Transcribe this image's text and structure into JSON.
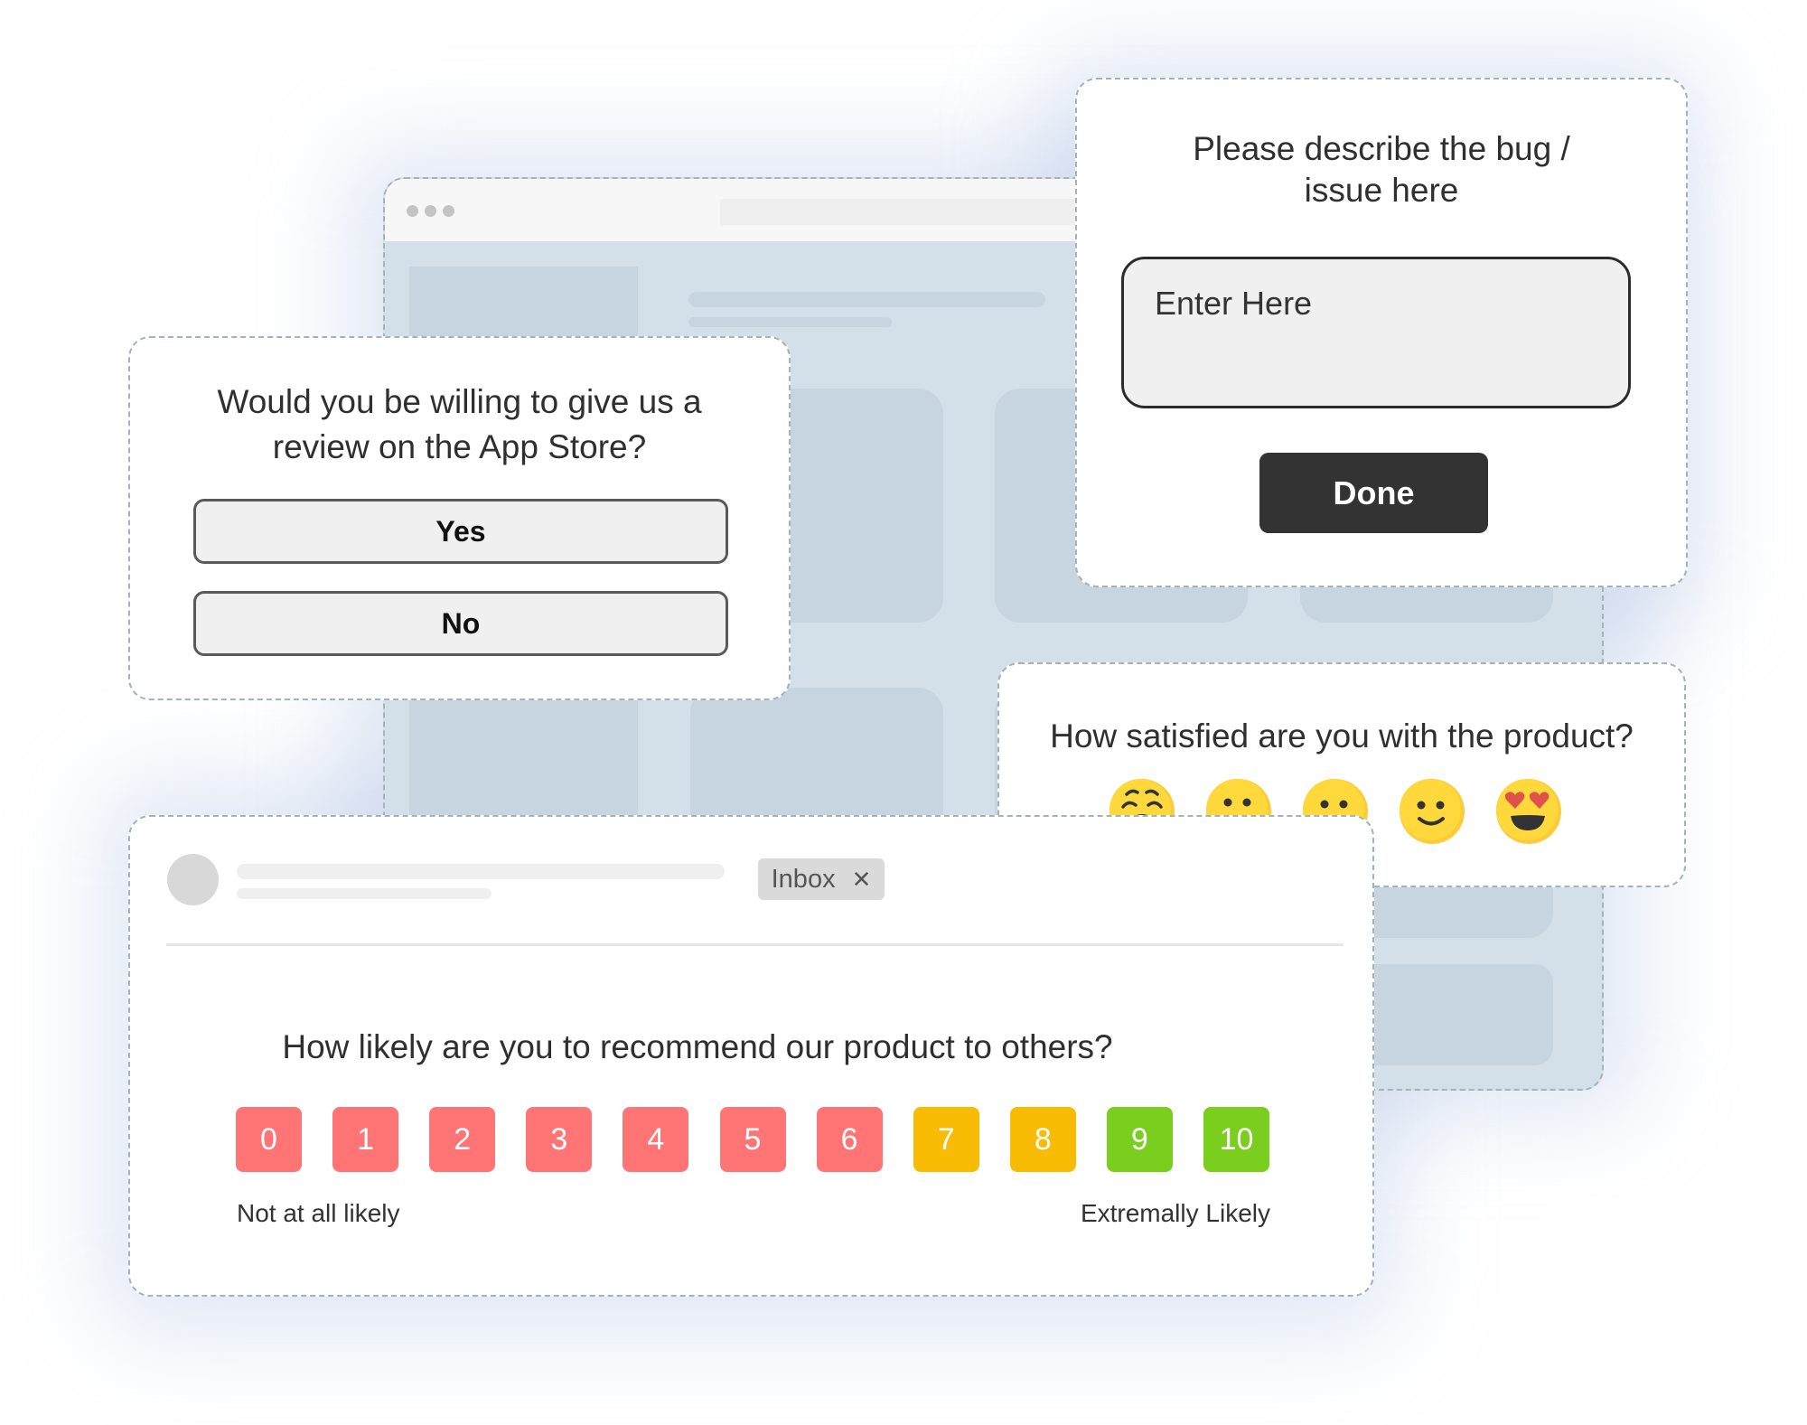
{
  "review_card": {
    "question_line1": "Would you be willing to give us a",
    "question_line2": "review on the App Store?",
    "options": [
      "Yes",
      "No"
    ]
  },
  "bug_card": {
    "title_line1": "Please describe the bug /",
    "title_line2": "issue here",
    "input_placeholder": "Enter Here",
    "submit_label": "Done"
  },
  "satisfaction_card": {
    "question": "How satisfied are you with the product?",
    "ratings": [
      {
        "icon": "crying-face-icon",
        "meaning": "very dissatisfied"
      },
      {
        "icon": "frowning-face-icon",
        "meaning": "dissatisfied"
      },
      {
        "icon": "neutral-face-icon",
        "meaning": "neutral"
      },
      {
        "icon": "smiling-face-icon",
        "meaning": "satisfied"
      },
      {
        "icon": "heart-eyes-face-icon",
        "meaning": "very satisfied"
      }
    ]
  },
  "email_card": {
    "label_chip": "Inbox",
    "chip_close_icon": "close-icon",
    "question": "How likely are you to recommend our product to others?",
    "scale": [
      {
        "value": "0",
        "color": "#FF7575"
      },
      {
        "value": "1",
        "color": "#FF7575"
      },
      {
        "value": "2",
        "color": "#FF7575"
      },
      {
        "value": "3",
        "color": "#FF7575"
      },
      {
        "value": "4",
        "color": "#FF7575"
      },
      {
        "value": "5",
        "color": "#FF7575"
      },
      {
        "value": "6",
        "color": "#FF7575"
      },
      {
        "value": "7",
        "color": "#F9BC05"
      },
      {
        "value": "8",
        "color": "#F9BC05"
      },
      {
        "value": "9",
        "color": "#7ACE1E"
      },
      {
        "value": "10",
        "color": "#7ACE1E"
      }
    ],
    "min_label": "Not at all likely",
    "max_label": "Extremally Likely"
  },
  "colors": {
    "dashed_border": "#A4B3BB",
    "browser_bg": "#D4E0E9",
    "placeholder_block": "#C6D5DF",
    "done_button": "#333333",
    "emoji_yellow": "#FFD93B"
  }
}
